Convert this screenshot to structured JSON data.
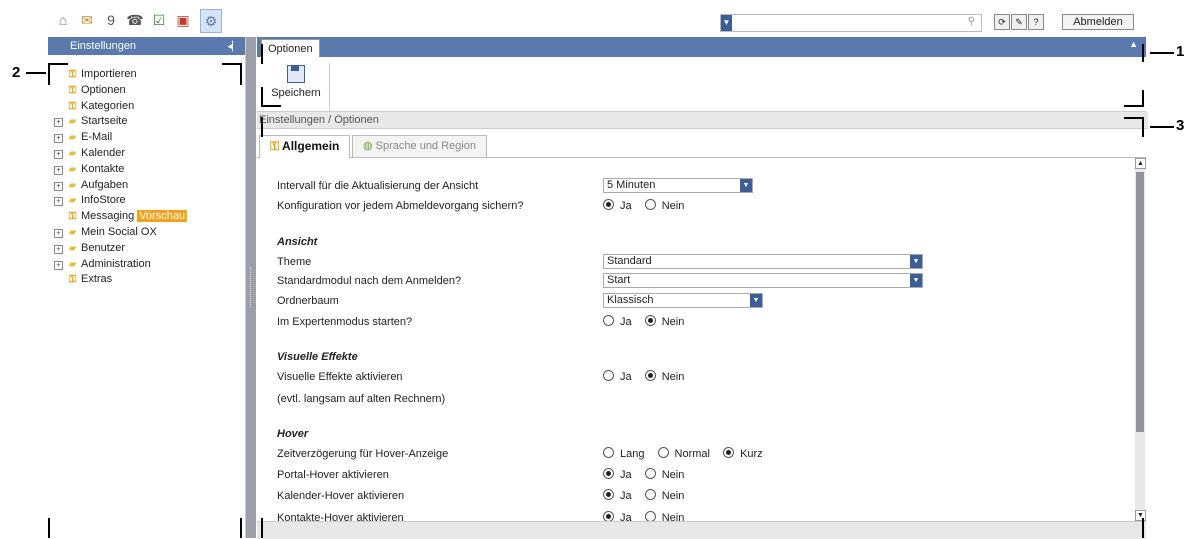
{
  "topbar": {
    "apps": [
      {
        "icon": "home-icon",
        "glyph": "⌂"
      },
      {
        "icon": "mail-icon",
        "glyph": "✉"
      },
      {
        "icon": "calendar-icon",
        "glyph": "9"
      },
      {
        "icon": "contacts-icon",
        "glyph": "☎"
      },
      {
        "icon": "tasks-icon",
        "glyph": "☑"
      },
      {
        "icon": "infostore-icon",
        "glyph": "▣"
      },
      {
        "icon": "settings-icon",
        "glyph": "⚙"
      }
    ],
    "logout_label": "Abmelden"
  },
  "left": {
    "header": "Einstellungen",
    "tree": [
      {
        "label": "Importieren",
        "type": "key",
        "expand": false,
        "indent": 1
      },
      {
        "label": "Optionen",
        "type": "key",
        "expand": false,
        "indent": 1
      },
      {
        "label": "Kategorien",
        "type": "key",
        "expand": false,
        "indent": 1
      },
      {
        "label": "Startseite",
        "type": "folder",
        "expand": true,
        "indent": 0
      },
      {
        "label": "E-Mail",
        "type": "folder",
        "expand": true,
        "indent": 0
      },
      {
        "label": "Kalender",
        "type": "folder",
        "expand": true,
        "indent": 0
      },
      {
        "label": "Kontakte",
        "type": "folder",
        "expand": true,
        "indent": 0
      },
      {
        "label": "Aufgaben",
        "type": "folder",
        "expand": true,
        "indent": 0
      },
      {
        "label": "InfoStore",
        "type": "folder",
        "expand": true,
        "indent": 0
      },
      {
        "label": "Messaging",
        "type": "key",
        "expand": false,
        "indent": 1,
        "badge": "Vorschau"
      },
      {
        "label": "Mein Social OX",
        "type": "folder",
        "expand": true,
        "indent": 0
      },
      {
        "label": "Benutzer",
        "type": "folder",
        "expand": true,
        "indent": 0
      },
      {
        "label": "Administration",
        "type": "folder",
        "expand": true,
        "indent": 0
      },
      {
        "label": "Extras",
        "type": "key",
        "expand": false,
        "indent": 1
      }
    ]
  },
  "right": {
    "tab": "Optionen",
    "save_label": "Speichern",
    "breadcrumb": "Einstellungen / Optionen",
    "subtabs": {
      "general": "Allgemein",
      "lang": "Sprache und Region"
    }
  },
  "form": {
    "interval_label": "Intervall für die Aktualisierung der Ansicht",
    "interval_value": "5 Minuten",
    "backup_label": "Konfiguration vor jedem Abmeldevorgang sichern?",
    "ja": "Ja",
    "nein": "Nein",
    "ansicht_title": "Ansicht",
    "theme_label": "Theme",
    "theme_value": "Standard",
    "startmodule_label": "Standardmodul nach dem Anmelden?",
    "startmodule_value": "Start",
    "folder_label": "Ordnerbaum",
    "folder_value": "Klassisch",
    "expert_label": "Im Expertenmodus starten?",
    "visual_title": "Visuelle Effekte",
    "visual_label": "Visuelle Effekte aktivieren",
    "visual_note": "(evtl. langsam auf alten Rechnern)",
    "hover_title": "Hover",
    "hoverdelay_label": "Zeitverzögerung für Hover-Anzeige",
    "lang": "Lang",
    "normal": "Normal",
    "kurz": "Kurz",
    "portal_label": "Portal-Hover aktivieren",
    "calendar_label": "Kalender-Hover aktivieren",
    "contacts_label": "Kontakte-Hover aktivieren"
  },
  "callouts": {
    "c1": "1",
    "c2": "2",
    "c3": "3"
  }
}
